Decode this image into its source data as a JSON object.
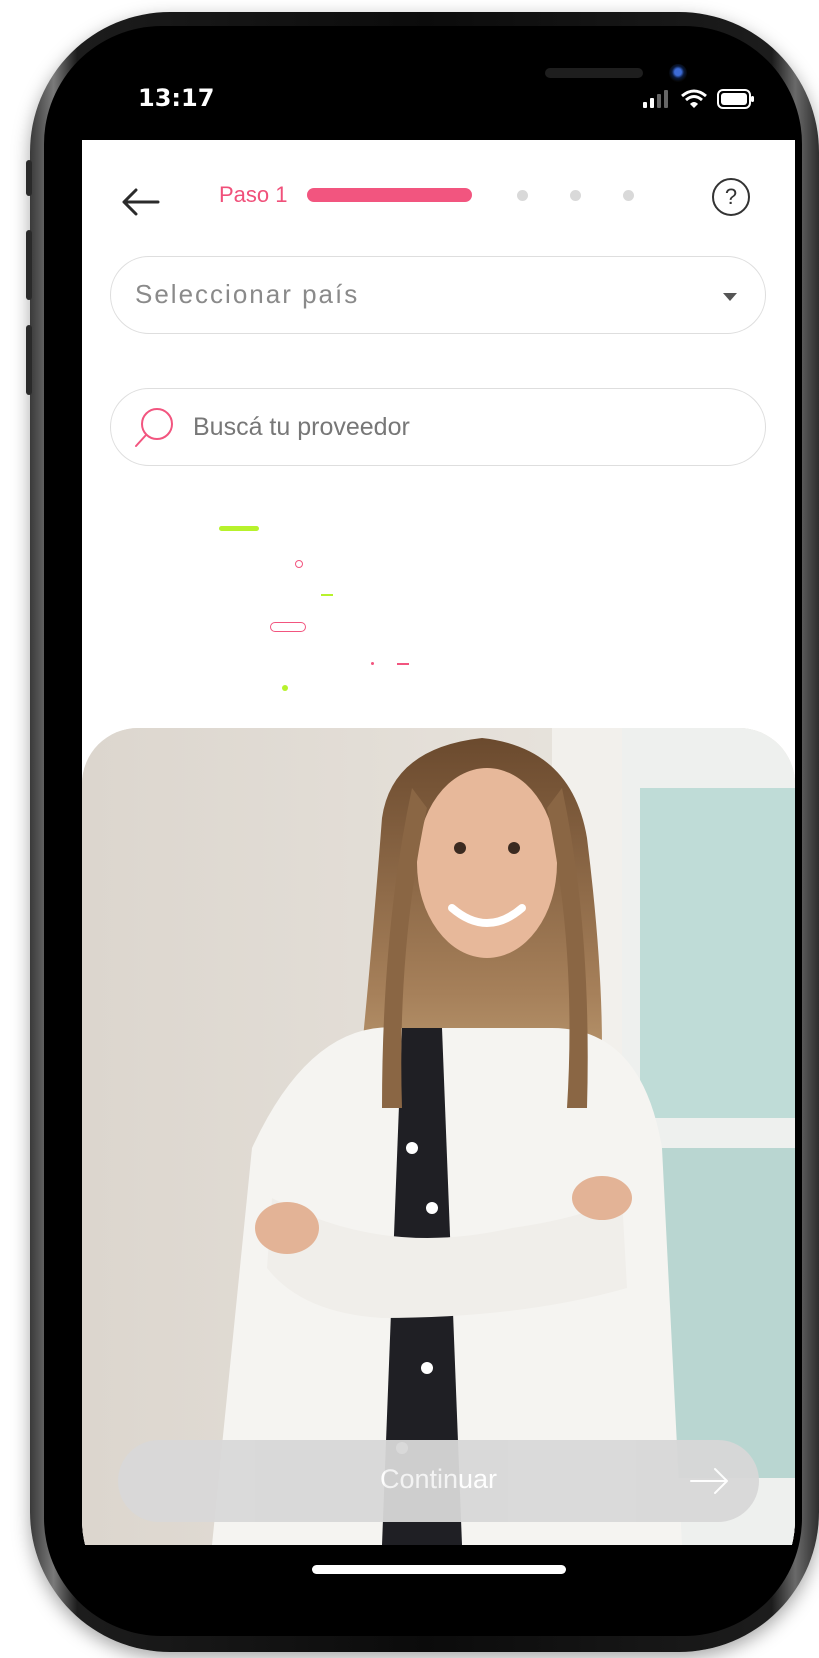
{
  "status_bar": {
    "time": "13:17",
    "icons": [
      "signal-icon",
      "wifi-icon",
      "battery-icon"
    ]
  },
  "header": {
    "step_label": "Paso 1",
    "progress": {
      "current_step": 1,
      "total_steps": 4
    },
    "help_symbol": "?"
  },
  "country_select": {
    "placeholder": "Seleccionar país"
  },
  "search": {
    "placeholder": "Buscá tu proveedor",
    "value": ""
  },
  "primary_button": {
    "label": "Continuar",
    "enabled": false
  },
  "colors": {
    "accent": "#f2557f",
    "lime": "#b7f22c",
    "disabled_button": "#d8d8d8"
  }
}
